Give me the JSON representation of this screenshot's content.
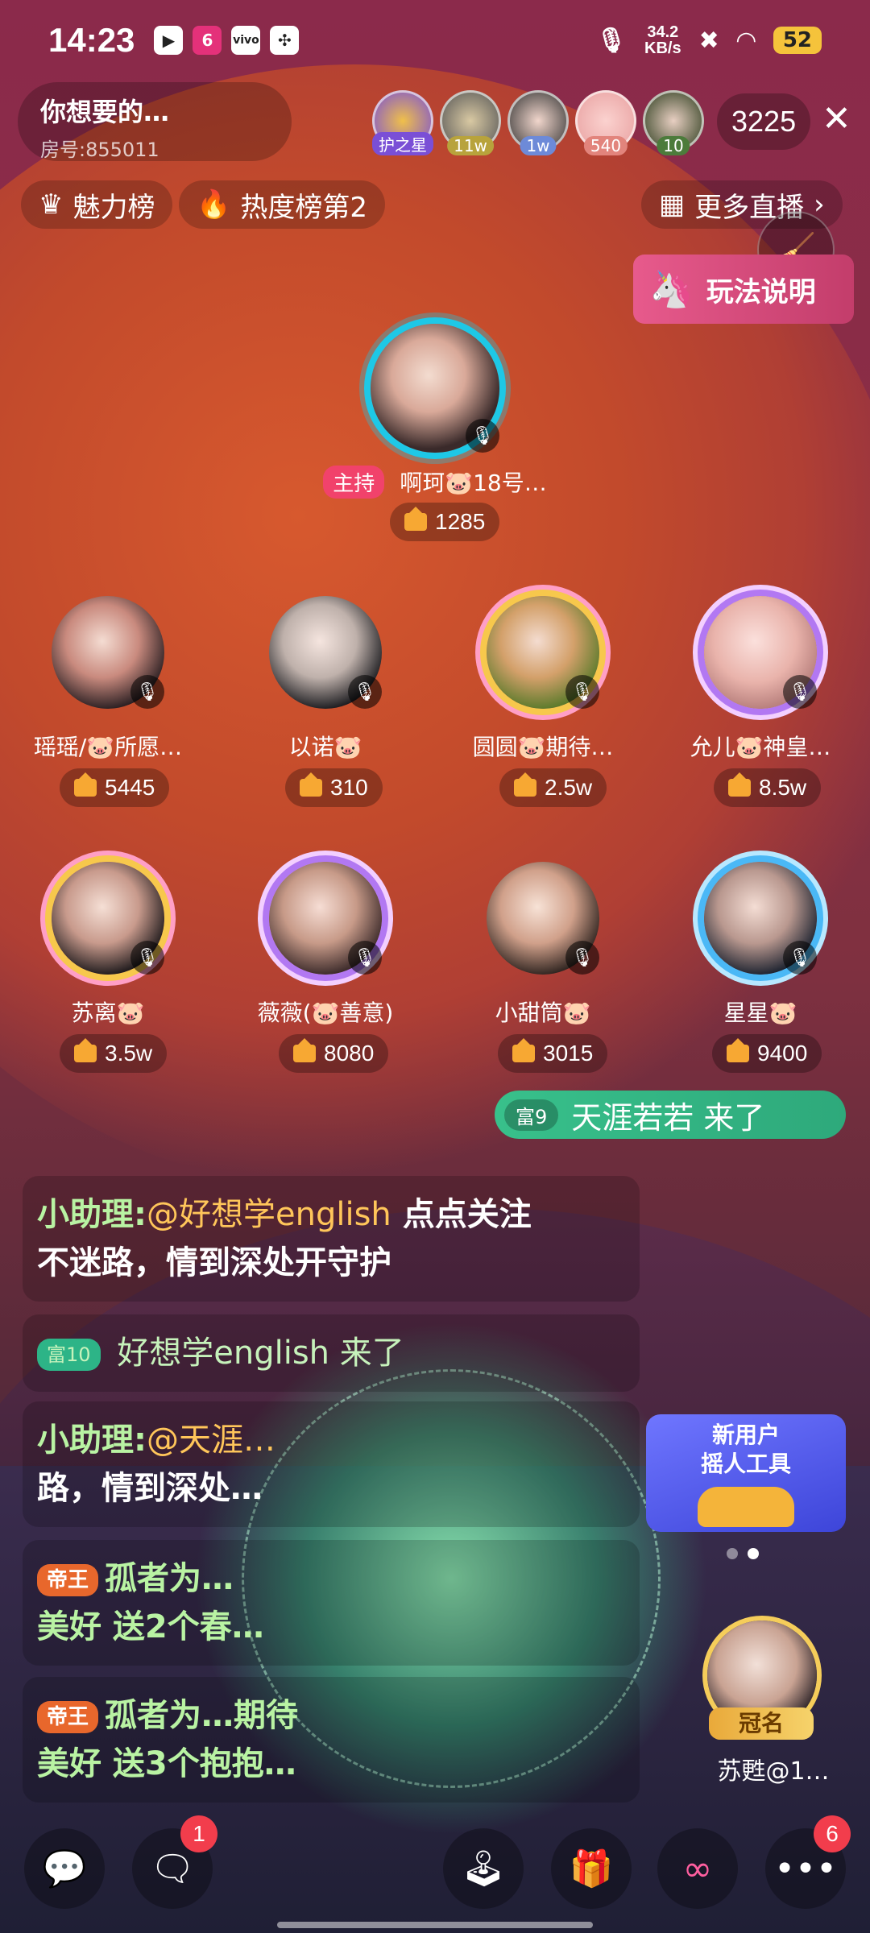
{
  "status_bar": {
    "time": "14:23",
    "net_speed_value": "34.2",
    "net_speed_unit": "KB/s",
    "battery": "52",
    "app_icons": [
      "video-app-icon",
      "app-6-icon",
      "vivo-icon",
      "pinwheel-icon"
    ]
  },
  "room": {
    "title": "你想要的…",
    "id_label": "房号:855011",
    "viewer_count": "3225"
  },
  "top_avatars": [
    {
      "tag": "护之星",
      "color": "#7a4fd6"
    },
    {
      "tag": "11w",
      "color": "#b8a33c"
    },
    {
      "tag": "1w",
      "color": "#6d8ad8"
    },
    {
      "tag": "540",
      "color": "#e2847c"
    },
    {
      "tag": "10",
      "color": "#4c7b3b"
    }
  ],
  "chips": {
    "charm": "魅力榜",
    "heat": "热度榜第2",
    "more": "更多直播"
  },
  "rules_button": "玩法说明",
  "host": {
    "badge": "主持",
    "name": "啊珂🐷18号…",
    "score": "1285"
  },
  "seats": [
    {
      "name": "瑶瑶/🐷所愿…",
      "score": "5445"
    },
    {
      "name": "以诺🐷",
      "score": "310"
    },
    {
      "name": "圆圆🐷期待…",
      "score": "2.5w"
    },
    {
      "name": "允儿🐷神皇…",
      "score": "8.5w"
    },
    {
      "name": "苏离🐷",
      "score": "3.5w"
    },
    {
      "name": "薇薇(🐷善意)",
      "score": "8080"
    },
    {
      "name": "小甜筒🐷",
      "score": "3015"
    },
    {
      "name": "星星🐷",
      "score": "9400"
    }
  ],
  "entrance": {
    "level": "富9",
    "text": "天涯若若 来了"
  },
  "chat": [
    {
      "assistant": "小助理:",
      "mention": "@好想学english",
      "text_a": " 点点关注",
      "text_b": "不迷路，情到深处开守护"
    },
    {
      "level": "富10",
      "text": "好想学english 来了"
    },
    {
      "assistant": "小助理:",
      "mention": "@天涯…",
      "text_b": "路，情到深处…"
    },
    {
      "badge": "帝王",
      "sender": "孤者为…",
      "text": "美好 送2个春…"
    },
    {
      "badge": "帝王",
      "sender": "孤者为…期待",
      "text": "美好 送3个抱抱…"
    }
  ],
  "promo": {
    "line1": "新用户",
    "line2": "摇人工具"
  },
  "sponsor": {
    "badge": "冠名",
    "name": "苏甦@1…"
  },
  "bottom": {
    "message_badge": "1",
    "more_badge": "6"
  }
}
